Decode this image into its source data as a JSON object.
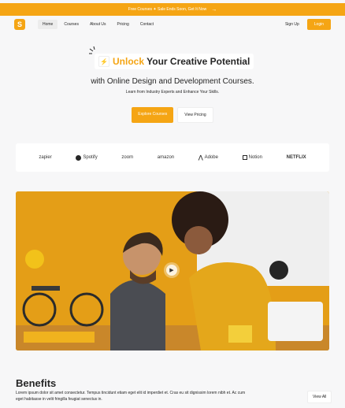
{
  "banner": {
    "text": "Free Courses ✦ Sale Ends Soon, Get It Now",
    "arrow": "→"
  },
  "nav": {
    "logo_glyph": "S",
    "links": [
      "Home",
      "Courses",
      "About Us",
      "Pricing",
      "Contact"
    ],
    "active_index": 0,
    "signup_label": "Sign Up",
    "login_label": "Login"
  },
  "hero_text": {
    "headline_accent": "Unlock",
    "headline_rest": "Your Creative Potential",
    "subheadline": "with Online Design and Development Courses.",
    "description": "Learn from Industry Experts and Enhance Your Skills.",
    "primary_cta": "Explore Courses",
    "secondary_cta": "View Pricing"
  },
  "brands": [
    "zapier",
    "Spotify",
    "zoom",
    "amazon",
    "Adobe",
    "Notion",
    "NETFLIX"
  ],
  "benefits": {
    "title": "Benefits",
    "description": "Lorem ipsum dolor sit amet consectetur. Tempus tincidunt etiam eget elit id imperdiet et. Cras eu sit dignissim lorem nibh et. Ac cum eget habitasse in velit fringilla feugiat senectus in.",
    "view_all_label": "View All"
  },
  "colors": {
    "accent": "#f5a514",
    "text": "#262626",
    "background": "#f7f7f8"
  }
}
